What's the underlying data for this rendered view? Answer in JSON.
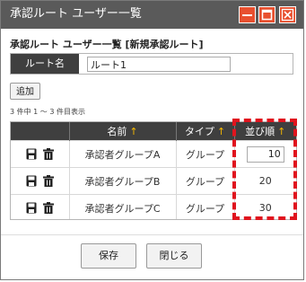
{
  "window": {
    "title": "承認ルート ユーザー一覧"
  },
  "heading": "承認ルート ユーザー一覧 [新規承認ルート]",
  "route": {
    "label": "ルート名",
    "value": "ルート1"
  },
  "add_label": "追加",
  "count_text": "3 件中 1 ～ 3 件目表示",
  "table": {
    "columns": [
      {
        "label": "",
        "sort": ""
      },
      {
        "label": "名前",
        "sort": "↑"
      },
      {
        "label": "タイプ",
        "sort": "↑"
      },
      {
        "label": "並び順",
        "sort": "↑"
      }
    ],
    "rows": [
      {
        "name": "承認者グループA",
        "type": "グループ",
        "order": "10",
        "order_editable": true
      },
      {
        "name": "承認者グループB",
        "type": "グループ",
        "order": "20",
        "order_editable": false
      },
      {
        "name": "承認者グループC",
        "type": "グループ",
        "order": "30",
        "order_editable": false
      }
    ]
  },
  "footer": {
    "save_label": "保存",
    "close_label": "閉じる"
  },
  "colors": {
    "titlebar": "#5a5a5a",
    "window_button": "#e8502f",
    "header_bg": "#3f3f3f",
    "sort_arrow": "#f5b800",
    "highlight_box": "#e0141e"
  },
  "icons": {
    "minimize": "minimize-icon",
    "maximize": "maximize-icon",
    "close": "close-icon",
    "save_row": "floppy-disk-icon",
    "delete_row": "trash-icon"
  }
}
